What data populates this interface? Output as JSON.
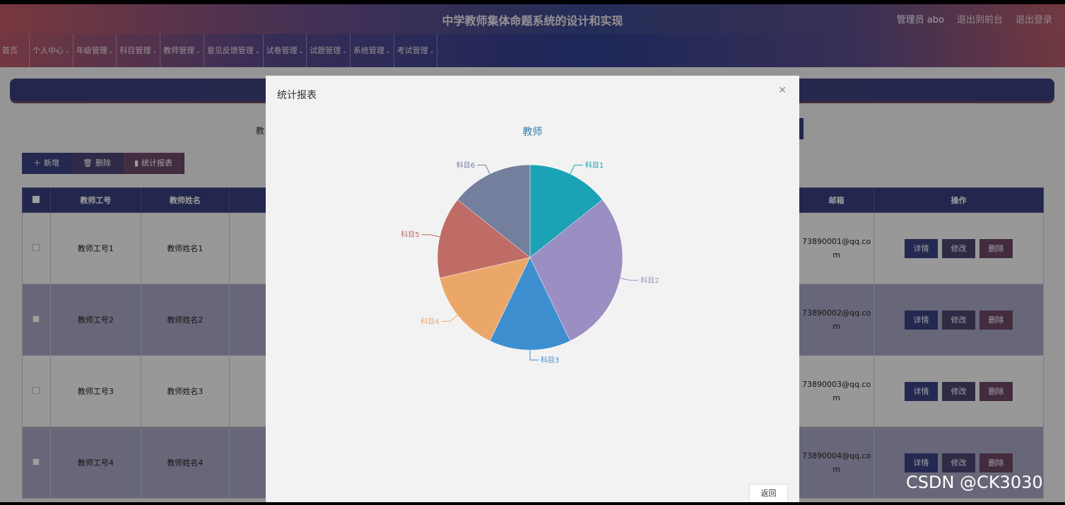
{
  "header": {
    "title": "中学教师集体命题系统的设计和实现",
    "user": "管理员 abo",
    "front_link": "退出到前台",
    "logout_link": "退出登录"
  },
  "menu": [
    {
      "label": "首页",
      "dropdown": false
    },
    {
      "label": "个人中心",
      "dropdown": true
    },
    {
      "label": "年级管理",
      "dropdown": true
    },
    {
      "label": "科目管理",
      "dropdown": true
    },
    {
      "label": "教师管理",
      "dropdown": true
    },
    {
      "label": "意见反馈管理",
      "dropdown": true
    },
    {
      "label": "试卷管理",
      "dropdown": true
    },
    {
      "label": "试题管理",
      "dropdown": true
    },
    {
      "label": "系统管理",
      "dropdown": true
    },
    {
      "label": "考试管理",
      "dropdown": true
    }
  ],
  "search": {
    "label": "教"
  },
  "toolbar": {
    "add": "新增",
    "delete": "删除",
    "stats": "统计报表"
  },
  "table": {
    "headers": {
      "id": "教师工号",
      "name": "教师姓名",
      "email": "邮箱",
      "ops": "操作"
    },
    "rows": [
      {
        "id": "教师工号1",
        "name": "教师姓名1",
        "email_line1": "73890001@qq.co",
        "email_line2": "m"
      },
      {
        "id": "教师工号2",
        "name": "教师姓名2",
        "email_line1": "73890002@qq.co",
        "email_line2": "m"
      },
      {
        "id": "教师工号3",
        "name": "教师姓名3",
        "email_line1": "73890003@qq.co",
        "email_line2": "m"
      },
      {
        "id": "教师工号4",
        "name": "教师姓名4",
        "email_line1": "73890004@qq.co",
        "email_line2": "m"
      }
    ],
    "op_detail": "详情",
    "op_edit": "修改",
    "op_delete": "删除"
  },
  "modal": {
    "title": "统计报表",
    "close_icon": "close-icon",
    "back": "返回"
  },
  "chart_data": {
    "type": "pie",
    "title": "教师",
    "slices": [
      {
        "label": "科目1",
        "value": 1,
        "color": "#1ba2b5"
      },
      {
        "label": "科目2",
        "value": 2,
        "color": "#9b8ec3"
      },
      {
        "label": "科目3",
        "value": 1,
        "color": "#3e8fd0"
      },
      {
        "label": "科目4",
        "value": 1,
        "color": "#eba76a"
      },
      {
        "label": "科目5",
        "value": 1,
        "color": "#c06c66"
      },
      {
        "label": "科目6",
        "value": 1,
        "color": "#737f9c"
      }
    ]
  },
  "watermark": "CSDN @CK3030"
}
